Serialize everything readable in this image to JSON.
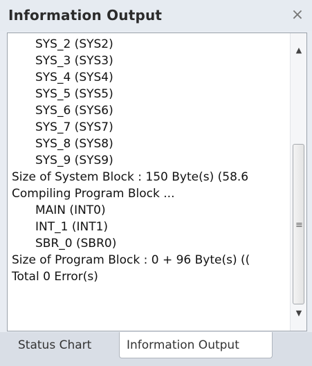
{
  "panel": {
    "title": "Information Output",
    "close_glyph": "×"
  },
  "output": {
    "lines": [
      {
        "text": "SYS_2 (SYS2)",
        "indent": true
      },
      {
        "text": "SYS_3 (SYS3)",
        "indent": true
      },
      {
        "text": "SYS_4 (SYS4)",
        "indent": true
      },
      {
        "text": "SYS_5 (SYS5)",
        "indent": true
      },
      {
        "text": "SYS_6 (SYS6)",
        "indent": true
      },
      {
        "text": "SYS_7 (SYS7)",
        "indent": true
      },
      {
        "text": "SYS_8 (SYS8)",
        "indent": true
      },
      {
        "text": "SYS_9 (SYS9)",
        "indent": true
      },
      {
        "text": "Size of System Block : 150 Byte(s) (58.6",
        "indent": false
      },
      {
        "text": "Compiling Program Block ...",
        "indent": false
      },
      {
        "text": "MAIN (INT0)",
        "indent": true
      },
      {
        "text": "INT_1 (INT1)",
        "indent": true
      },
      {
        "text": "SBR_0 (SBR0)",
        "indent": true
      },
      {
        "text": "Size of Program Block : 0 + 96 Byte(s) ((",
        "indent": false
      },
      {
        "text": "Total 0 Error(s)",
        "indent": false
      }
    ]
  },
  "scrollbar": {
    "up_glyph": "▲",
    "down_glyph": "▼",
    "grip_glyph": "≡"
  },
  "tabs": [
    {
      "label": "Status Chart",
      "active": false
    },
    {
      "label": "Information Output",
      "active": true
    }
  ]
}
